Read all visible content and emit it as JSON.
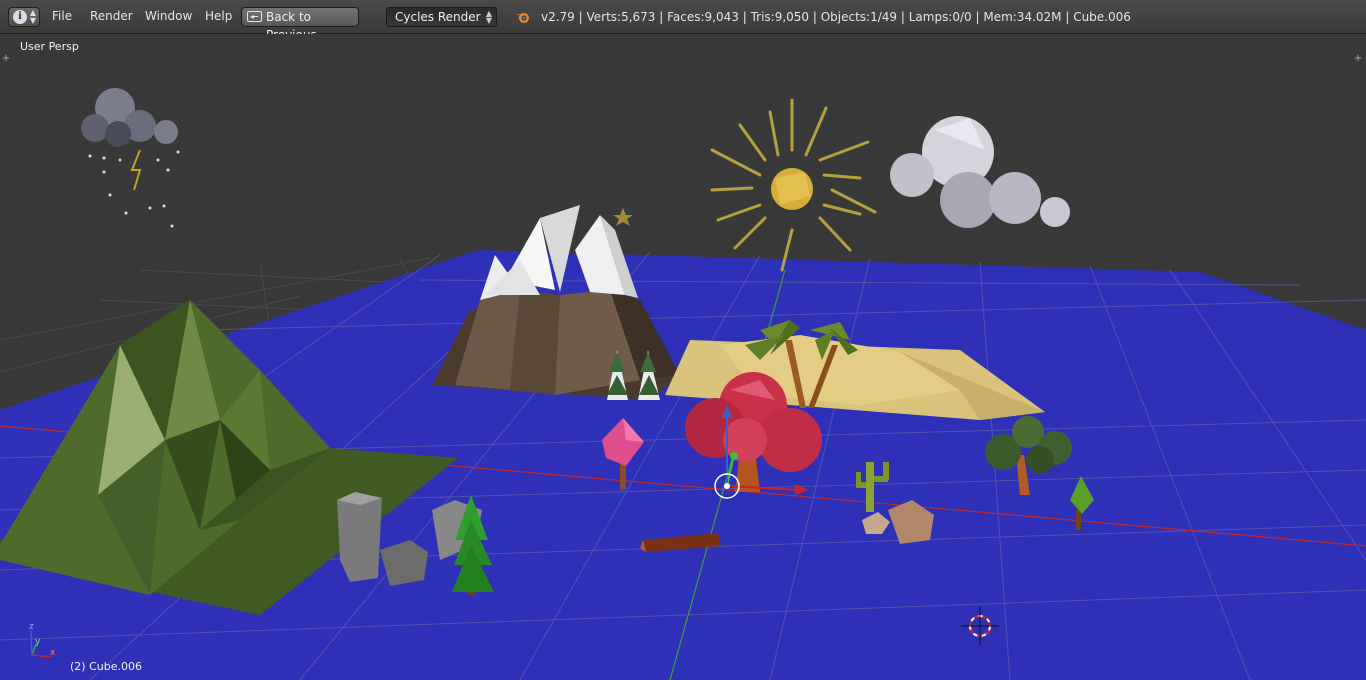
{
  "header": {
    "editor_type_icon": "info-icon",
    "menus": [
      "File",
      "Render",
      "Window",
      "Help"
    ],
    "back_button_label": "Back to Previous",
    "render_engine": "Cycles Render",
    "logo_icon": "blender-logo-icon",
    "stats": "v2.79 | Verts:5,673 | Faces:9,043 | Tris:9,050 | Objects:1/49 | Lamps:0/0 | Mem:34.02M | Cube.006"
  },
  "viewport": {
    "view_label": "User Persp",
    "object_label": "(2) Cube.006",
    "axis_labels": [
      "x",
      "y",
      "z"
    ],
    "colors": {
      "background": "#393939",
      "ground_plane": "#2e30b8",
      "grid_line": "#5b5b68",
      "x_axis": "#c0282a",
      "y_axis": "#3aa03a",
      "z_axis": "#3a5fd0"
    },
    "objects": [
      "storm-cloud",
      "moon",
      "star",
      "sun",
      "cloud",
      "snowy-mountain",
      "green-mountain",
      "desert-dunes",
      "palm-trees",
      "snowy-pine-trees",
      "red-tree",
      "pink-tree",
      "rocks",
      "pine-tree",
      "log",
      "cactus",
      "boulders",
      "bushy-tree",
      "small-tree",
      "3d-cursor",
      "transform-gizmo",
      "axis-widget"
    ]
  }
}
